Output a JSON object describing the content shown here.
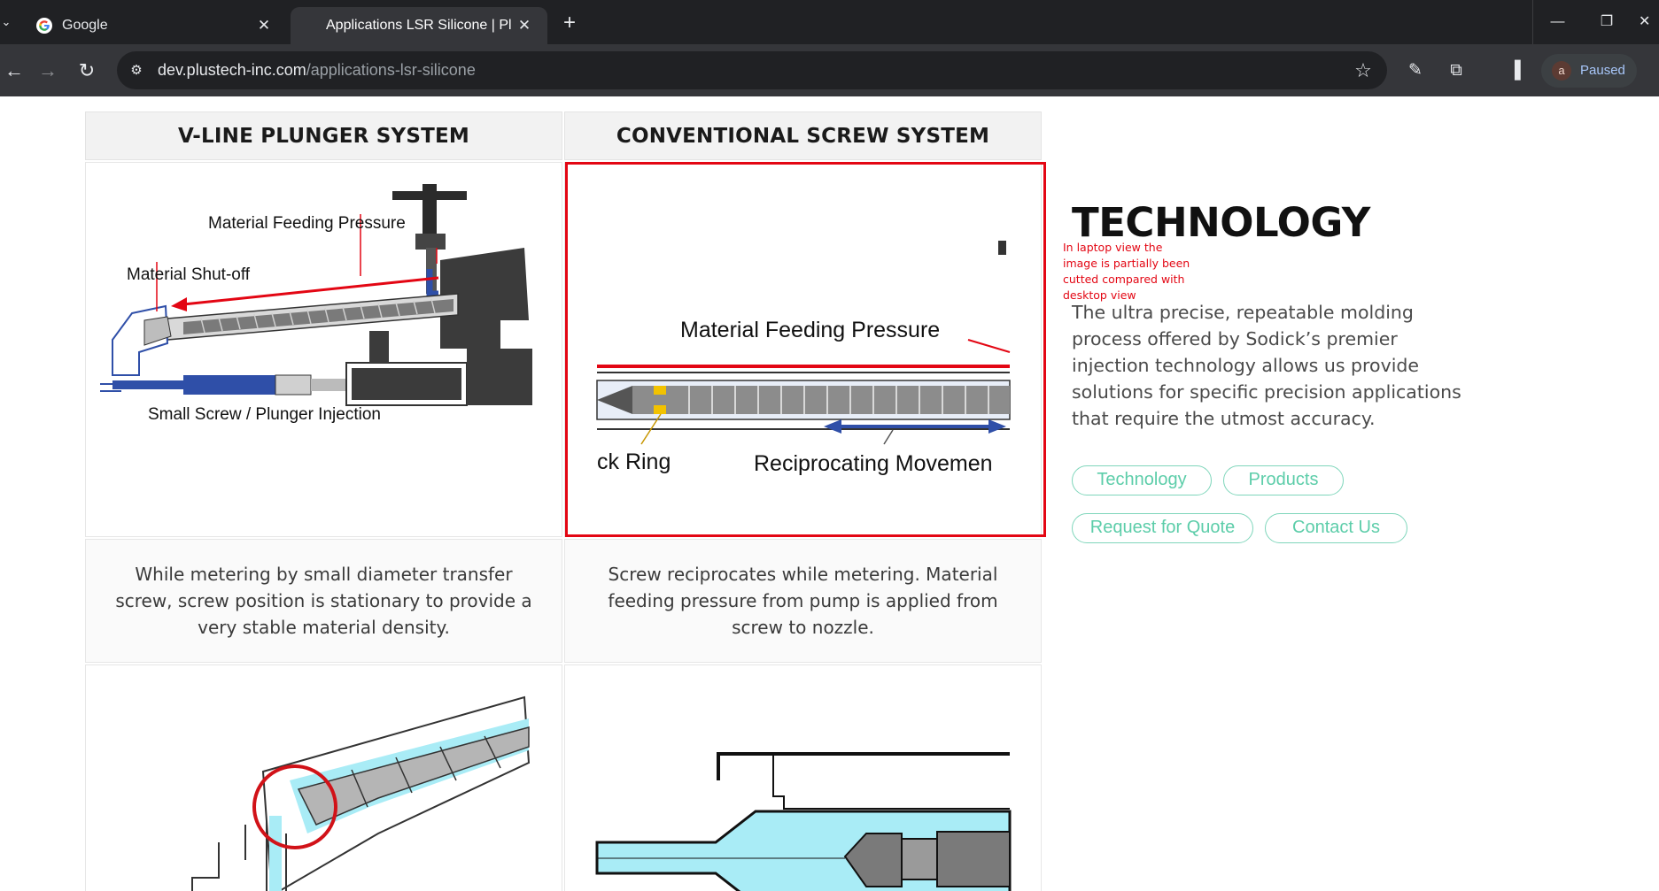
{
  "browser": {
    "tabs": [
      {
        "title": "Google",
        "active": false,
        "favicon": "google-g-icon"
      },
      {
        "title": "Applications LSR Silicone | Plustech",
        "active": true
      }
    ],
    "new_tab_label": "+",
    "url_host": "dev.plustech-inc.com",
    "url_path": "/applications-lsr-silicone",
    "profile_initial": "a",
    "profile_status": "Paused"
  },
  "page": {
    "columns": [
      {
        "heading": "V-LINE PLUNGER SYSTEM",
        "diagram_labels": {
          "feeding_pressure": "Material Feeding Pressure",
          "shutoff": "Material Shut-off",
          "injection": "Small Screw / Plunger Injection"
        },
        "description": "While metering by small diameter transfer screw, screw position is stationary to provide a very stable material density."
      },
      {
        "heading": "CONVENTIONAL SCREW SYSTEM",
        "diagram_labels": {
          "feeding_pressure": "Material Feeding Pressure",
          "check_ring": "ck Ring",
          "reciprocating": "Reciprocating Movemen"
        },
        "description": "Screw reciprocates while metering. Material feeding pressure from pump is applied from screw to nozzle."
      }
    ],
    "annotation_note": "In laptop view the image is partially  been cutted compared with desktop view",
    "technology": {
      "title": "TECHNOLOGY",
      "body": "The ultra precise, repeatable molding process offered by Sodick’s premier injection technology allows us provide solutions for specific precision applications that require the utmost accuracy.",
      "buttons": {
        "technology": "Technology",
        "products": "Products",
        "quote": "Request for Quote",
        "contact": "Contact Us"
      }
    },
    "colors": {
      "accent_green": "#5ccda9",
      "annotation_red": "#e30613",
      "diagram_red": "#e30613",
      "diagram_blue": "#2f4fa8",
      "diagram_cyan": "#9fe3f2"
    }
  }
}
